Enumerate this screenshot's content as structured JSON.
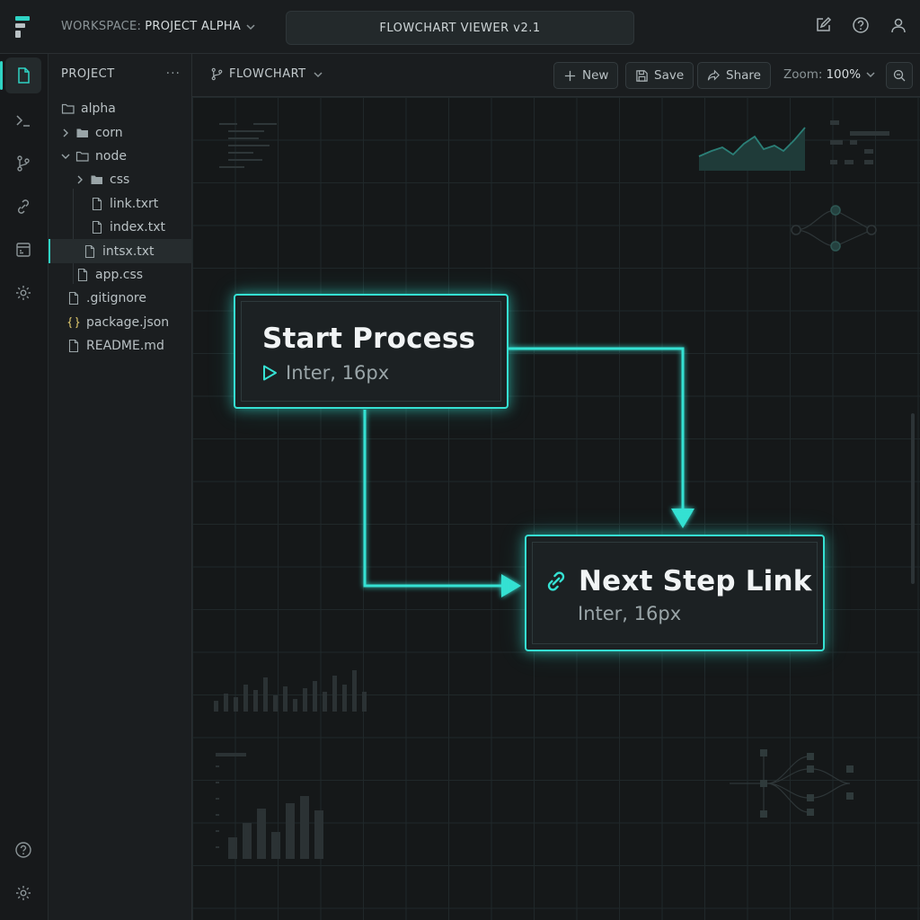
{
  "workspace": {
    "prefix": "WORKSPACE:",
    "name": "PROJECT ALPHA"
  },
  "app_title": "FLOWCHART VIEWER v2.1",
  "explorer": {
    "title": "PROJECT",
    "more": "···",
    "tree": [
      {
        "label": "alpha",
        "type": "folder-open"
      },
      {
        "label": "corn",
        "type": "folder"
      },
      {
        "label": "node",
        "type": "folder-open"
      },
      {
        "label": "css",
        "type": "folder"
      },
      {
        "label": "link.txrt",
        "type": "file"
      },
      {
        "label": "index.txt",
        "type": "file"
      },
      {
        "label": "intsx.txt",
        "type": "file",
        "selected": true
      },
      {
        "label": "app.css",
        "type": "file"
      },
      {
        "label": ".gitignore",
        "type": "file"
      },
      {
        "label": "package.json",
        "type": "json"
      },
      {
        "label": "README.md",
        "type": "file"
      }
    ]
  },
  "toolbar": {
    "branch": "FLOWCHART",
    "new_label": "New",
    "save_label": "Save",
    "share_label": "Share",
    "zoom_prefix": "Zoom:",
    "zoom_value": "100%"
  },
  "nodes": {
    "start": {
      "title": "Start Process",
      "subtitle": "Inter, 16px"
    },
    "next": {
      "title": "Next Step Link",
      "subtitle": "Inter, 16px"
    }
  },
  "colors": {
    "accent": "#35e1d3",
    "background": "#151819",
    "panel": "#1b1e20"
  }
}
